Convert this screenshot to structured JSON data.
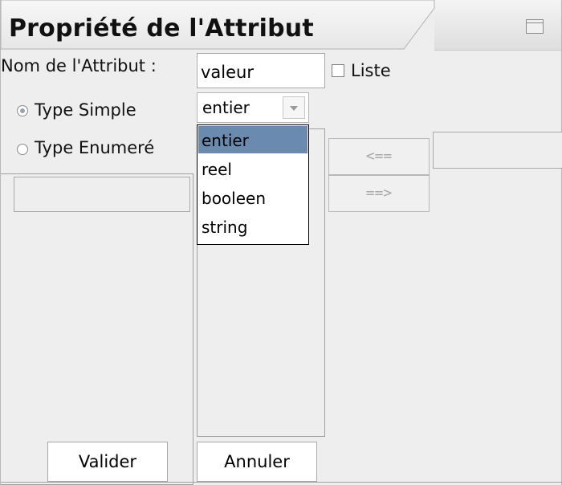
{
  "window": {
    "title": "Propriété de l'Attribut"
  },
  "form": {
    "name_label": "Nom de l'Attribut :",
    "name_value": "valeur",
    "list_label": "Liste",
    "list_checked": false,
    "type_simple_label": "Type Simple",
    "type_simple_selected": true,
    "type_enum_label": "Type Enumeré",
    "type_enum_selected": false,
    "type_combo_value": "entier"
  },
  "dropdown": {
    "options": [
      "entier",
      "reel",
      "booleen",
      "string"
    ],
    "selected_index": 0
  },
  "buttons": {
    "move_left": "<==",
    "move_right": "==>",
    "validate": "Valider",
    "cancel": "Annuler"
  },
  "colors": {
    "selection": "#6a8ab0",
    "background": "#eeeeee"
  },
  "icons": {
    "window_control": "maximize-icon"
  }
}
